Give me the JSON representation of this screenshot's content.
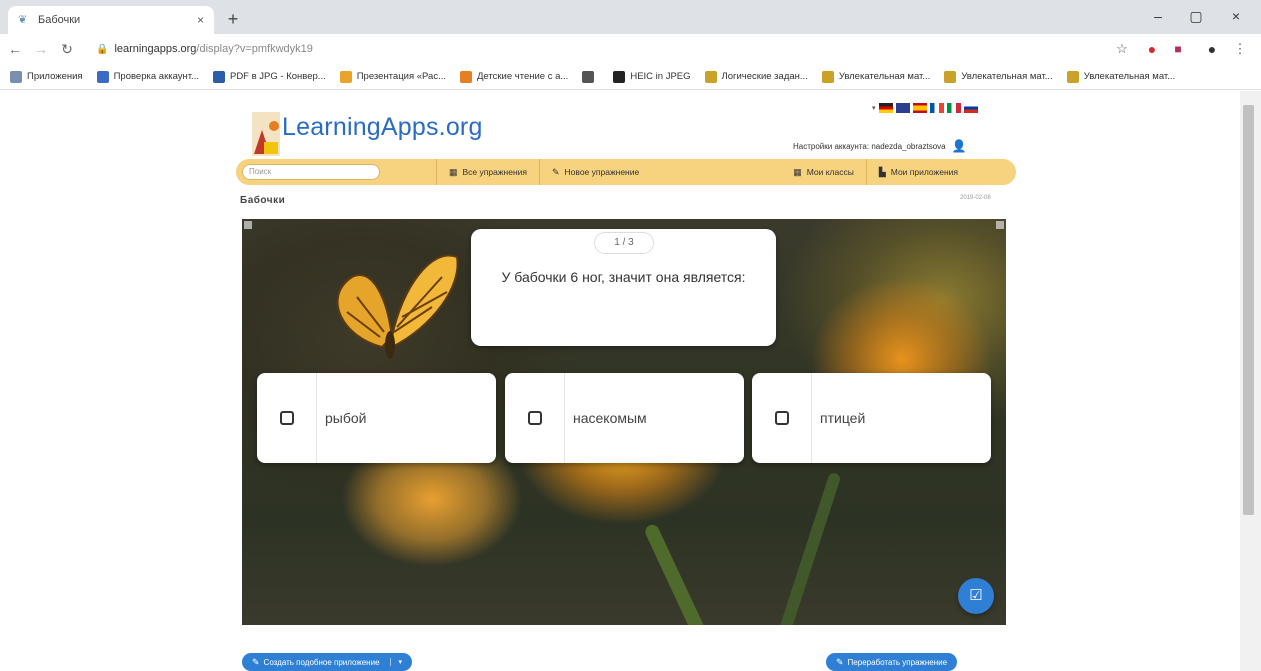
{
  "browser": {
    "tab_title": "Бабочки",
    "tab_close": "×",
    "new_tab": "+",
    "window_minimize": "–",
    "window_maximize": "▢",
    "window_close": "×",
    "url_host": "learningapps.org",
    "url_path": "/display?v=pmfkwdyk19",
    "bookmarks": [
      {
        "label": "Приложения",
        "color": "#7a8fb0"
      },
      {
        "label": "Проверка аккаунт...",
        "color": "#3b6bc4"
      },
      {
        "label": "PDF в JPG - Конвер...",
        "color": "#2b5ea8"
      },
      {
        "label": "Презентация «Рас...",
        "color": "#e8a52a"
      },
      {
        "label": "Детские чтение с а...",
        "color": "#e67e22"
      },
      {
        "label": "",
        "color": "#555555"
      },
      {
        "label": "HEIC in JPEG",
        "color": "#222222"
      },
      {
        "label": "Логические задан...",
        "color": "#c9a227"
      },
      {
        "label": "Увлекательная мат...",
        "color": "#c9a227"
      },
      {
        "label": "Увлекательная мат...",
        "color": "#c9a227"
      },
      {
        "label": "Увлекательная мат...",
        "color": "#c9a227"
      }
    ]
  },
  "site": {
    "logo": "LearningApps.org",
    "account_label": "Настройки аккаунта: nadezda_obraztsova",
    "search_placeholder": "Поиск",
    "menu": {
      "all_exercises": "Все упражнения",
      "new_exercise": "Новое упражнение",
      "my_classes": "Мои классы",
      "my_apps": "Мои приложения"
    },
    "page_title": "Бабочки",
    "date": "2019-02-08"
  },
  "quiz": {
    "counter": "1 / 3",
    "question": "У бабочки 6 ног, значит она является:",
    "answers": [
      {
        "label": "рыбой"
      },
      {
        "label": "насекомым"
      },
      {
        "label": "птицей"
      }
    ],
    "check_icon": "check-icon"
  },
  "footer": {
    "create_similar": "Создать подобное приложение",
    "rework": "Переработать упражнение"
  }
}
